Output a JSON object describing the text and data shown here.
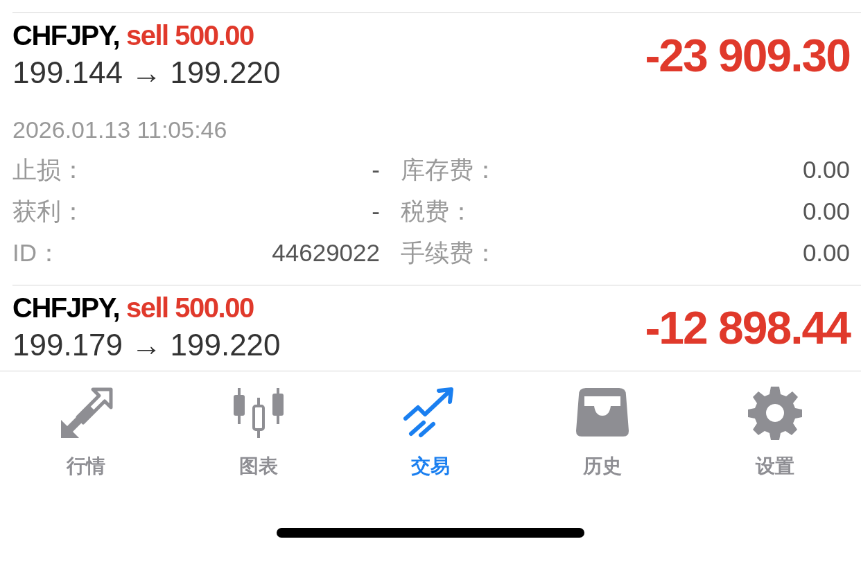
{
  "trades": [
    {
      "symbol": "CHFJPY,",
      "side": "sell 500.00",
      "prices": "199.144 → 199.220",
      "profit": "-23 909.30",
      "time": "2026.01.13 11:05:46",
      "details": [
        [
          {
            "label": "止损：",
            "value": "-"
          },
          {
            "label": "库存费：",
            "value": "0.00"
          }
        ],
        [
          {
            "label": "获利：",
            "value": "-"
          },
          {
            "label": "税费：",
            "value": "0.00"
          }
        ],
        [
          {
            "label": "ID：",
            "value": "44629022"
          },
          {
            "label": "手续费：",
            "value": "0.00"
          }
        ]
      ]
    },
    {
      "symbol": "CHFJPY,",
      "side": "sell 500.00",
      "prices": "199.179 → 199.220",
      "profit": "-12 898.44"
    }
  ],
  "tabs": [
    {
      "label": "行情",
      "kind": "arrows",
      "selected": false
    },
    {
      "label": "图表",
      "kind": "candles",
      "selected": false
    },
    {
      "label": "交易",
      "kind": "trend",
      "selected": true
    },
    {
      "label": "历史",
      "kind": "tray",
      "selected": false
    },
    {
      "label": "设置",
      "kind": "gear",
      "selected": false
    }
  ]
}
